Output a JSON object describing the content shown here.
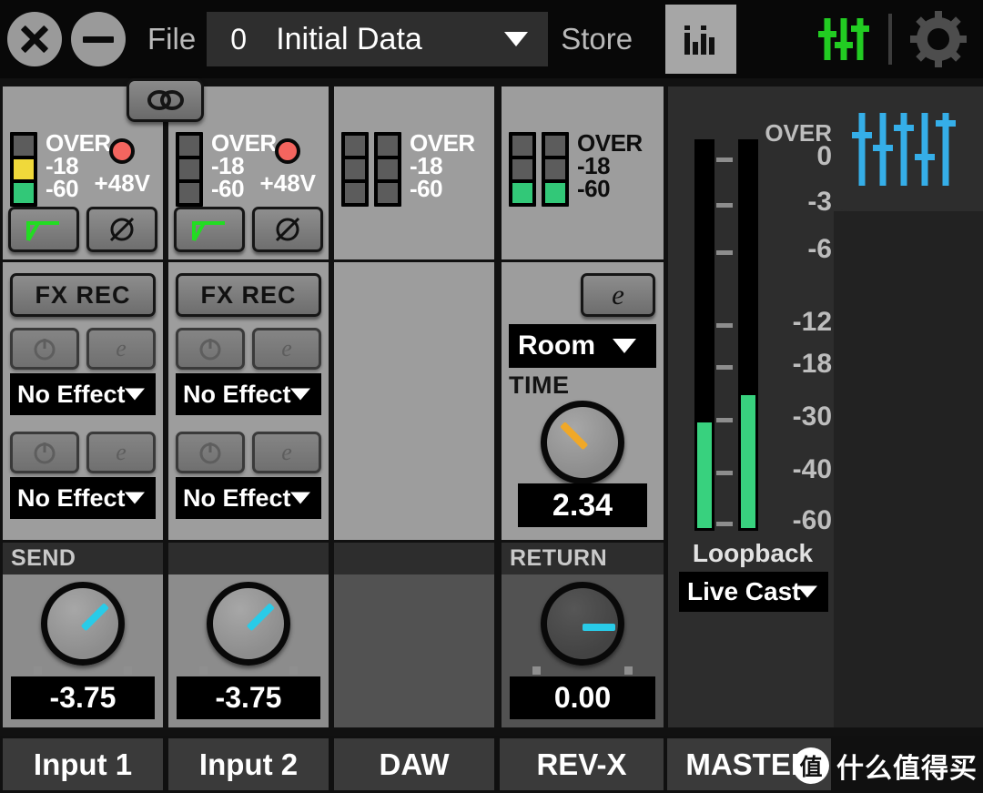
{
  "toolbar": {
    "close_icon": "close-icon",
    "minimize_icon": "minimize-icon",
    "file_label": "File",
    "scene_number": "0",
    "scene_name": "Initial Data",
    "store_label": "Store",
    "meter_icon": "bar-meter-icon",
    "fader_icon": "faders-icon",
    "settings_icon": "gear-icon"
  },
  "channels": [
    {
      "name": "Input 1",
      "meter": {
        "labels": [
          "OVER",
          "-18",
          "-60"
        ],
        "label_color": "#ffffff",
        "segments": [
          "off",
          "yellow",
          "green"
        ],
        "stacks": 1
      },
      "phantom": {
        "label": "+48V",
        "on": true
      },
      "hpf_icon": "highpass-filter-icon",
      "phase_icon": "phase-invert-icon",
      "fx_rec_label": "FX REC",
      "fx_slots": [
        {
          "power_icon": "power-icon",
          "edit_icon": "edit-icon",
          "effect": "No Effect"
        },
        {
          "power_icon": "power-icon",
          "edit_icon": "edit-icon",
          "effect": "No Effect"
        }
      ],
      "send": {
        "label": "SEND",
        "value": "-3.75",
        "angle": -45,
        "color": "#29cbe8"
      }
    },
    {
      "name": "Input 2",
      "meter": {
        "labels": [
          "OVER",
          "-18",
          "-60"
        ],
        "label_color": "#ffffff",
        "segments": [
          "off",
          "off",
          "off"
        ],
        "stacks": 1
      },
      "phantom": {
        "label": "+48V",
        "on": true
      },
      "hpf_icon": "highpass-filter-icon",
      "phase_icon": "phase-invert-icon",
      "fx_rec_label": "FX REC",
      "fx_slots": [
        {
          "power_icon": "power-icon",
          "edit_icon": "edit-icon",
          "effect": "No Effect"
        },
        {
          "power_icon": "power-icon",
          "edit_icon": "edit-icon",
          "effect": "No Effect"
        }
      ],
      "send": {
        "label": "",
        "value": "-3.75",
        "angle": -45,
        "color": "#29cbe8"
      }
    },
    {
      "name": "DAW",
      "meter": {
        "labels": [
          "OVER",
          "-18",
          "-60"
        ],
        "label_color": "#ffffff",
        "segments": [
          "off",
          "off",
          "off"
        ],
        "stacks": 2
      },
      "send": {
        "label": "",
        "value": "",
        "angle": 0,
        "color": "#29cbe8"
      }
    },
    {
      "name": "REV-X",
      "meter": {
        "labels": [
          "OVER",
          "-18",
          "-60"
        ],
        "label_color": "#0d0d0d",
        "segments": [
          "off",
          "off",
          "green"
        ],
        "stacks": 2
      },
      "edit_icon": "edit-icon",
      "reverb_type": "Room",
      "time_label": "TIME",
      "time_value": "2.34",
      "time_angle": -135,
      "time_color": "#f0a828",
      "return": {
        "label": "RETURN",
        "value": "0.00",
        "angle": 0,
        "color": "#29cbe8"
      }
    }
  ],
  "link_button": {
    "icon": "link-icon"
  },
  "master": {
    "name": "MASTER",
    "scale": [
      "OVER",
      "0",
      "-3",
      "-6",
      "-12",
      "-18",
      "-30",
      "-40",
      "-60"
    ],
    "meter_left_percent": 27,
    "meter_right_percent": 34,
    "loopback_label": "Loopback",
    "loopback_value": "Live Cast",
    "fader_icon": "faders-icon"
  },
  "watermark": {
    "mark": "值",
    "text": "什么值得买"
  }
}
